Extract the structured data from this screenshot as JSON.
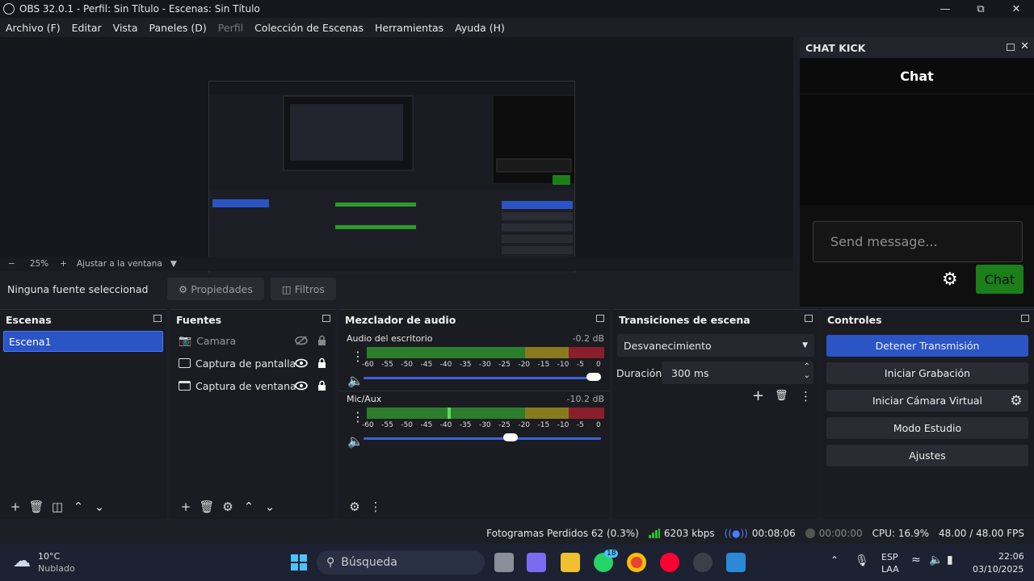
{
  "window": {
    "title": "OBS 32.0.1 - Perfil: Sin Título - Escenas: Sin Título"
  },
  "menu": [
    "Archivo (F)",
    "Editar",
    "Vista",
    "Paneles (D)",
    "Perfil",
    "Colección de Escenas",
    "Herramientas",
    "Ayuda (H)"
  ],
  "preview": {
    "zoom": "25%",
    "fit_label": "Ajustar a la ventana"
  },
  "source_toolbar": {
    "no_source": "Ninguna fuente seleccionad",
    "properties": "Propiedades",
    "filters": "Filtros"
  },
  "chat": {
    "dock_title": "CHAT KICK",
    "title": "Chat",
    "placeholder": "Send message...",
    "send_button": "Chat"
  },
  "scenes": {
    "title": "Escenas",
    "items": [
      "Escena1"
    ]
  },
  "sources": {
    "title": "Fuentes",
    "items": [
      {
        "name": "Camara",
        "visible": false
      },
      {
        "name": "Captura de pantalla",
        "visible": true
      },
      {
        "name": "Captura de ventana",
        "visible": true
      }
    ]
  },
  "mixer": {
    "title": "Mezclador de audio",
    "scale": [
      "-60",
      "-55",
      "-50",
      "-45",
      "-40",
      "-35",
      "-30",
      "-25",
      "-20",
      "-15",
      "-10",
      "-5",
      "0"
    ],
    "channels": [
      {
        "name": "Audio del escritorio",
        "db": "-0.2 dB",
        "volume": 1.0
      },
      {
        "name": "Mic/Aux",
        "db": "-10.2 dB",
        "volume": 0.65
      }
    ]
  },
  "transitions": {
    "title": "Transiciones de escena",
    "selected": "Desvanecimiento",
    "duration_label": "Duración",
    "duration_value": "300 ms"
  },
  "controls": {
    "title": "Controles",
    "stop_stream": "Detener Transmisión",
    "start_record": "Iniciar Grabación",
    "virtual_cam": "Iniciar Cámara Virtual",
    "studio_mode": "Modo Estudio",
    "settings": "Ajustes"
  },
  "status": {
    "dropped": "Fotogramas Perdidos 62 (0.3%)",
    "kbps": "6203 kbps",
    "stream_time": "00:08:06",
    "rec_time": "00:00:00",
    "cpu": "CPU: 16.9%",
    "fps": "48.00 / 48.00 FPS"
  },
  "taskbar": {
    "temp": "10°C",
    "weather": "Nublado",
    "search": "Búsqueda",
    "badge": "18",
    "lang1": "ESP",
    "lang2": "LAA",
    "time": "22:06",
    "date": "03/10/2025"
  },
  "colors": {
    "accent": "#2b54c5",
    "chat_green": "#1b7f1a",
    "meter_green": "#2c9a2c",
    "meter_yellow": "#9a8a1e",
    "meter_red": "#9a1e2a"
  }
}
